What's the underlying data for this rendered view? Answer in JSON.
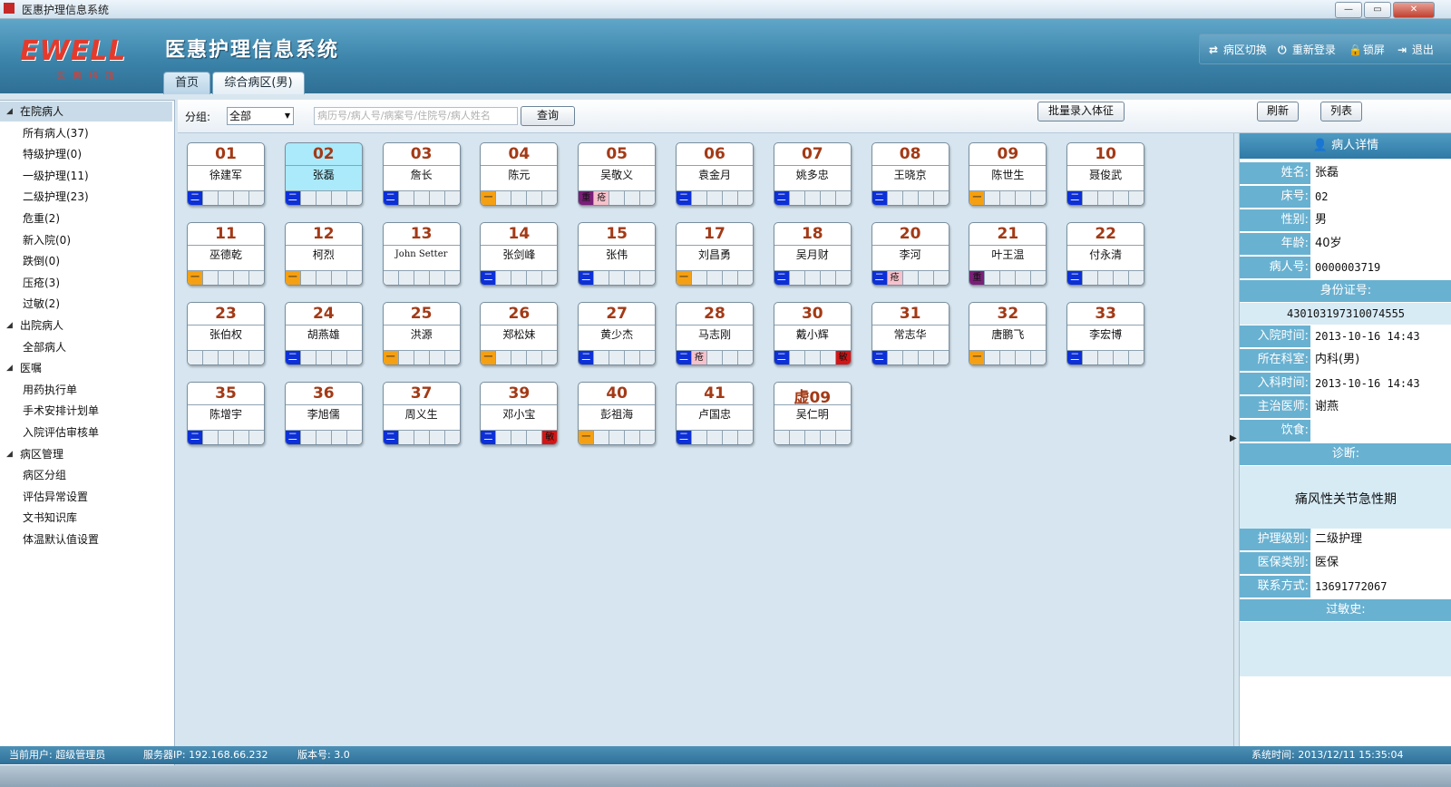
{
  "window": {
    "title": "医惠护理信息系统",
    "min": "—",
    "max": "▭",
    "close": "✕"
  },
  "header": {
    "logo_text": "EWELL",
    "logo_sub": "医惠科技",
    "app_title": "医惠护理信息系统",
    "tabs": [
      {
        "label": "首页",
        "active": false
      },
      {
        "label": "综合病区(男)",
        "active": true
      }
    ],
    "actions": [
      {
        "label": "病区切换",
        "icon": "switch-icon"
      },
      {
        "label": "重新登录",
        "icon": "power-icon"
      },
      {
        "label": "锁屏",
        "icon": "lock-icon"
      },
      {
        "label": "退出",
        "icon": "exit-icon"
      }
    ]
  },
  "sidebar": {
    "nodes": [
      {
        "label": "在院病人",
        "level": 0,
        "selected": true
      },
      {
        "label": "所有病人(37)",
        "level": 1
      },
      {
        "label": "特级护理(0)",
        "level": 1
      },
      {
        "label": "一级护理(11)",
        "level": 1
      },
      {
        "label": "二级护理(23)",
        "level": 1
      },
      {
        "label": "危重(2)",
        "level": 1
      },
      {
        "label": "新入院(0)",
        "level": 1
      },
      {
        "label": "跌倒(0)",
        "level": 1
      },
      {
        "label": "压疮(3)",
        "level": 1
      },
      {
        "label": "过敏(2)",
        "level": 1
      },
      {
        "label": "出院病人",
        "level": 0
      },
      {
        "label": "全部病人",
        "level": 1
      },
      {
        "label": "医嘱",
        "level": 0
      },
      {
        "label": "用药执行单",
        "level": 1
      },
      {
        "label": "手术安排计划单",
        "level": 1
      },
      {
        "label": "入院评估审核单",
        "level": 1
      },
      {
        "label": "病区管理",
        "level": 0
      },
      {
        "label": "病区分组",
        "level": 1
      },
      {
        "label": "评估异常设置",
        "level": 1
      },
      {
        "label": "文书知识库",
        "level": 1
      },
      {
        "label": "体温默认值设置",
        "level": 1
      }
    ]
  },
  "toolbar": {
    "group_label": "分组:",
    "group_value": "全部",
    "search_placeholder": "病历号/病人号/病案号/住院号/病人姓名",
    "query_button": "查询",
    "batch_button": "批量录入体征",
    "refresh_button": "刷新",
    "list_button": "列表"
  },
  "beds": [
    {
      "num": "01",
      "name": "徐建军",
      "s": [
        "二",
        "",
        "",
        "",
        ""
      ]
    },
    {
      "num": "02",
      "name": "张磊",
      "s": [
        "二",
        "",
        "",
        "",
        ""
      ],
      "selected": true
    },
    {
      "num": "03",
      "name": "詹长",
      "s": [
        "二",
        "",
        "",
        "",
        ""
      ]
    },
    {
      "num": "04",
      "name": "陈元",
      "s": [
        "一",
        "",
        "",
        "",
        ""
      ]
    },
    {
      "num": "05",
      "name": "吴敬义",
      "s": [
        "重",
        "疮",
        "",
        "",
        ""
      ]
    },
    {
      "num": "06",
      "name": "袁金月",
      "s": [
        "二",
        "",
        "",
        "",
        ""
      ]
    },
    {
      "num": "07",
      "name": "姚多忠",
      "s": [
        "二",
        "",
        "",
        "",
        ""
      ]
    },
    {
      "num": "08",
      "name": "王晓京",
      "s": [
        "二",
        "",
        "",
        "",
        ""
      ]
    },
    {
      "num": "09",
      "name": "陈世生",
      "s": [
        "一",
        "",
        "",
        "",
        ""
      ]
    },
    {
      "num": "10",
      "name": "聂俊武",
      "s": [
        "二",
        "",
        "",
        "",
        ""
      ]
    },
    {
      "num": "11",
      "name": "巫德乾",
      "s": [
        "一",
        "",
        "",
        "",
        ""
      ]
    },
    {
      "num": "12",
      "name": "柯烈",
      "s": [
        "一",
        "",
        "",
        "",
        ""
      ]
    },
    {
      "num": "13",
      "name": "John Setter",
      "s": [
        "",
        "",
        "",
        "",
        ""
      ],
      "small": true
    },
    {
      "num": "14",
      "name": "张剑峰",
      "s": [
        "二",
        "",
        "",
        "",
        ""
      ]
    },
    {
      "num": "15",
      "name": "张伟",
      "s": [
        "二",
        "",
        "",
        "",
        ""
      ]
    },
    {
      "num": "17",
      "name": "刘昌勇",
      "s": [
        "一",
        "",
        "",
        "",
        ""
      ]
    },
    {
      "num": "18",
      "name": "吴月财",
      "s": [
        "二",
        "",
        "",
        "",
        ""
      ]
    },
    {
      "num": "20",
      "name": "李河",
      "s": [
        "二",
        "疮",
        "",
        "",
        ""
      ]
    },
    {
      "num": "21",
      "name": "叶王温",
      "s": [
        "重",
        "",
        "",
        "",
        ""
      ]
    },
    {
      "num": "22",
      "name": "付永清",
      "s": [
        "二",
        "",
        "",
        "",
        ""
      ]
    },
    {
      "num": "23",
      "name": "张伯权",
      "s": [
        "",
        "",
        "",
        "",
        ""
      ]
    },
    {
      "num": "24",
      "name": "胡燕雄",
      "s": [
        "二",
        "",
        "",
        "",
        ""
      ]
    },
    {
      "num": "25",
      "name": "洪源",
      "s": [
        "一",
        "",
        "",
        "",
        ""
      ]
    },
    {
      "num": "26",
      "name": "郑松妹",
      "s": [
        "一",
        "",
        "",
        "",
        ""
      ]
    },
    {
      "num": "27",
      "name": "黄少杰",
      "s": [
        "二",
        "",
        "",
        "",
        ""
      ]
    },
    {
      "num": "28",
      "name": "马志刚",
      "s": [
        "二",
        "疮",
        "",
        "",
        ""
      ]
    },
    {
      "num": "30",
      "name": "戴小辉",
      "s": [
        "二",
        "",
        "",
        "",
        "敏"
      ]
    },
    {
      "num": "31",
      "name": "常志华",
      "s": [
        "二",
        "",
        "",
        "",
        ""
      ]
    },
    {
      "num": "32",
      "name": "唐鹏飞",
      "s": [
        "一",
        "",
        "",
        "",
        ""
      ]
    },
    {
      "num": "33",
      "name": "李宏博",
      "s": [
        "二",
        "",
        "",
        "",
        ""
      ]
    },
    {
      "num": "35",
      "name": "陈增宇",
      "s": [
        "二",
        "",
        "",
        "",
        ""
      ]
    },
    {
      "num": "36",
      "name": "李旭儒",
      "s": [
        "二",
        "",
        "",
        "",
        ""
      ]
    },
    {
      "num": "37",
      "name": "周义生",
      "s": [
        "二",
        "",
        "",
        "",
        ""
      ]
    },
    {
      "num": "39",
      "name": "邓小宝",
      "s": [
        "二",
        "",
        "",
        "",
        "敏"
      ]
    },
    {
      "num": "40",
      "name": "彭祖海",
      "s": [
        "一",
        "",
        "",
        "",
        ""
      ]
    },
    {
      "num": "41",
      "name": "卢国忠",
      "s": [
        "二",
        "",
        "",
        "",
        ""
      ]
    },
    {
      "num": "虚09",
      "name": "吴仁明",
      "s": [
        "",
        "",
        "",
        "",
        ""
      ]
    }
  ],
  "slot_colors": {
    "二": "#0c2fd8",
    "一": "#f5a012",
    "重": "#7a1f78",
    "疮": "#f6c1cb",
    "敏": "#d51515"
  },
  "detail": {
    "header": "病人详情",
    "name_k": "姓名:",
    "name_v": "张磊",
    "bed_k": "床号:",
    "bed_v": "02",
    "sex_k": "性别:",
    "sex_v": "男",
    "age_k": "年龄:",
    "age_v": "40岁",
    "pid_k": "病人号:",
    "pid_v": "0000003719",
    "idcard_k": "身份证号:",
    "idcard_v": "430103197310074555",
    "admit_k": "入院时间:",
    "admit_v": "2013-10-16 14:43",
    "dept_k": "所在科室:",
    "dept_v": "内科(男)",
    "deptin_k": "入科时间:",
    "deptin_v": "2013-10-16 14:43",
    "doctor_k": "主治医师:",
    "doctor_v": "谢燕",
    "diet_k": "饮食:",
    "diet_v": "",
    "diag_k": "诊断:",
    "diag_v": "痛风性关节急性期",
    "care_k": "护理级别:",
    "care_v": "二级护理",
    "ins_k": "医保类别:",
    "ins_v": "医保",
    "contact_k": "联系方式:",
    "contact_v": "13691772067",
    "allergy_k": "过敏史:",
    "allergy_v": ""
  },
  "status": {
    "user": "当前用户:  超级管理员",
    "server": "服务器IP:  192.168.66.232",
    "version": "版本号:  3.0",
    "time": "系统时间:  2013/12/11 15:35:04"
  }
}
